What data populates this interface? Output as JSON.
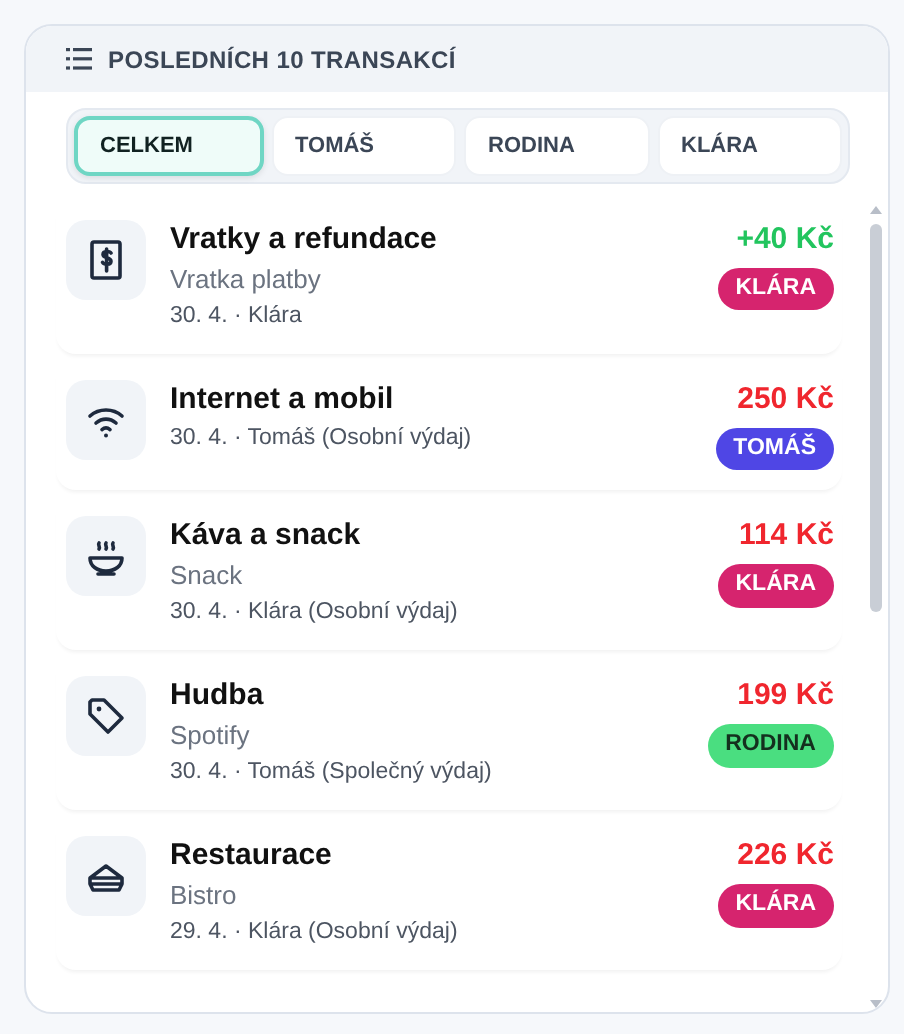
{
  "panel": {
    "title": "POSLEDNÍCH 10 TRANSAKCÍ"
  },
  "tabs": [
    {
      "label": "CELKEM",
      "selected": true
    },
    {
      "label": "TOMÁŠ",
      "selected": false
    },
    {
      "label": "RODINA",
      "selected": false
    },
    {
      "label": "KLÁRA",
      "selected": false
    }
  ],
  "transactions": [
    {
      "title": "Vratky a refundace",
      "subtitle": "Vratka platby",
      "meta": "30. 4. · Klára",
      "amount": "+40 Kč",
      "kind": "income",
      "badge": {
        "label": "KLÁRA",
        "color": "#d6246e"
      }
    },
    {
      "title": "Internet a mobil",
      "meta": "30. 4. · Tomáš (Osobní výdaj)",
      "amount": "250 Kč",
      "kind": "expense",
      "badge": {
        "label": "TOMÁŠ",
        "color": "#4f46e5"
      }
    },
    {
      "title": "Káva a snack",
      "subtitle": "Snack",
      "meta": "30. 4. · Klára (Osobní výdaj)",
      "amount": "114 Kč",
      "kind": "expense",
      "badge": {
        "label": "KLÁRA",
        "color": "#d6246e"
      }
    },
    {
      "title": "Hudba",
      "subtitle": "Spotify",
      "meta": "30. 4. · Tomáš (Společný výdaj)",
      "amount": "199 Kč",
      "kind": "expense",
      "badge": {
        "label": "RODINA",
        "color": "#4ade80"
      }
    },
    {
      "title": "Restaurace",
      "subtitle": "Bistro",
      "meta": "29. 4. · Klára (Osobní výdaj)",
      "amount": "226 Kč",
      "kind": "expense",
      "badge": {
        "label": "KLÁRA",
        "color": "#d6246e"
      }
    }
  ]
}
